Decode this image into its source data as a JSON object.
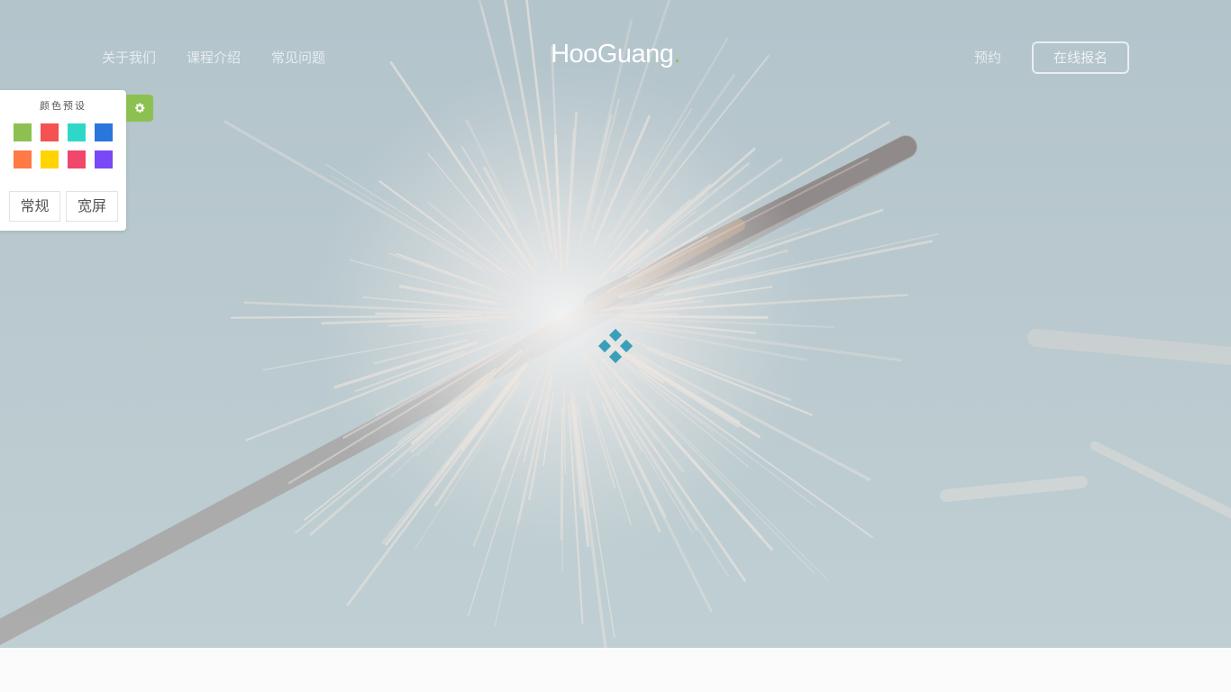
{
  "header": {
    "nav_left": [
      "关于我们",
      "课程介绍",
      "常见问题"
    ],
    "brand_name": "HooGuang",
    "brand_dot": ".",
    "reserve_label": "预约",
    "signup_label": "在线报名"
  },
  "color_panel": {
    "title": "颜色预设",
    "swatches": [
      "#8cc152",
      "#f55353",
      "#2ed8c8",
      "#2a76dd",
      "#ff7a45",
      "#ffd400",
      "#f0476b",
      "#7a48f5"
    ],
    "layout_options": [
      "常规",
      "宽屏"
    ],
    "toggle_icon": "gear-icon"
  },
  "loader": {
    "icon": "loading-diamonds-icon",
    "color": "#3a9fb8"
  },
  "colors": {
    "accent": "#8cc152"
  }
}
